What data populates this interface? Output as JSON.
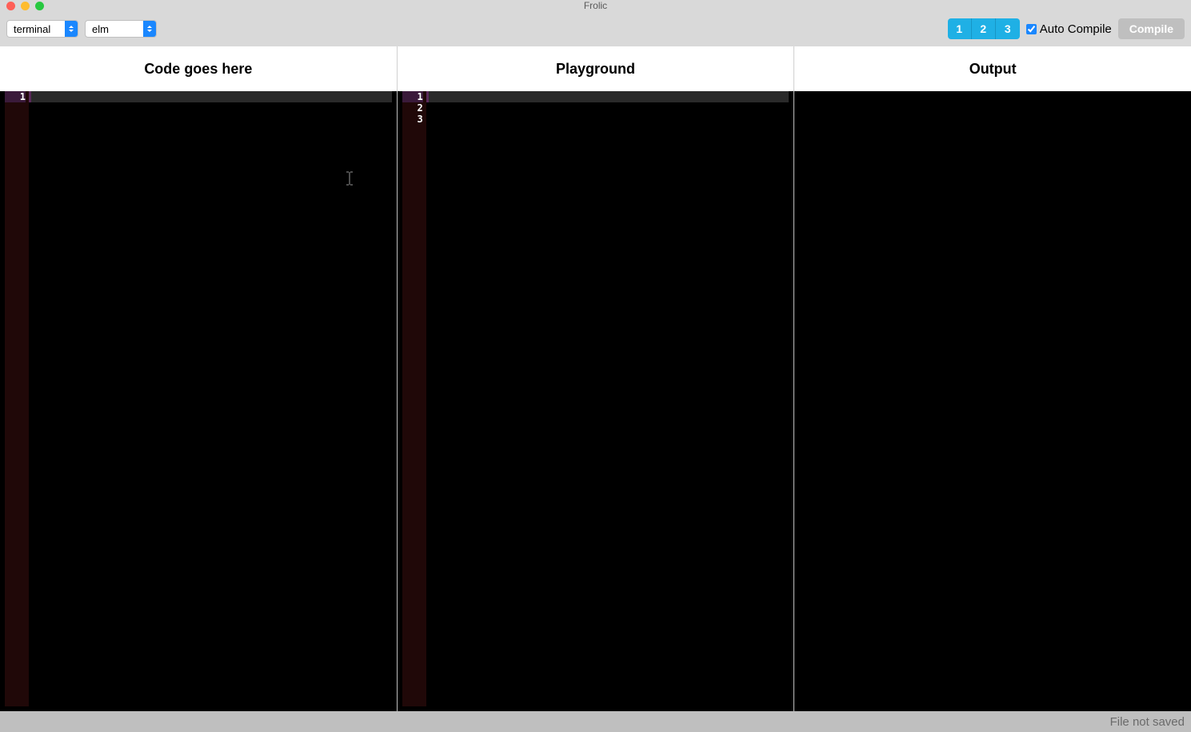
{
  "app": {
    "title": "Frolic"
  },
  "toolbar": {
    "select1": {
      "value": "terminal",
      "options": [
        "terminal"
      ]
    },
    "select2": {
      "value": "elm",
      "options": [
        "elm"
      ]
    },
    "layout_buttons": [
      "1",
      "2",
      "3"
    ],
    "auto_compile_label": "Auto Compile",
    "auto_compile_checked": true,
    "compile_label": "Compile"
  },
  "panes": {
    "headers": [
      "Code goes here",
      "Playground",
      "Output"
    ]
  },
  "editors": {
    "code": {
      "line_numbers": [
        "1"
      ],
      "active_line": 1,
      "content": ""
    },
    "playground": {
      "line_numbers": [
        "1",
        "2",
        "3"
      ],
      "active_line": 1,
      "content": ""
    }
  },
  "status": {
    "text": "File not saved"
  }
}
